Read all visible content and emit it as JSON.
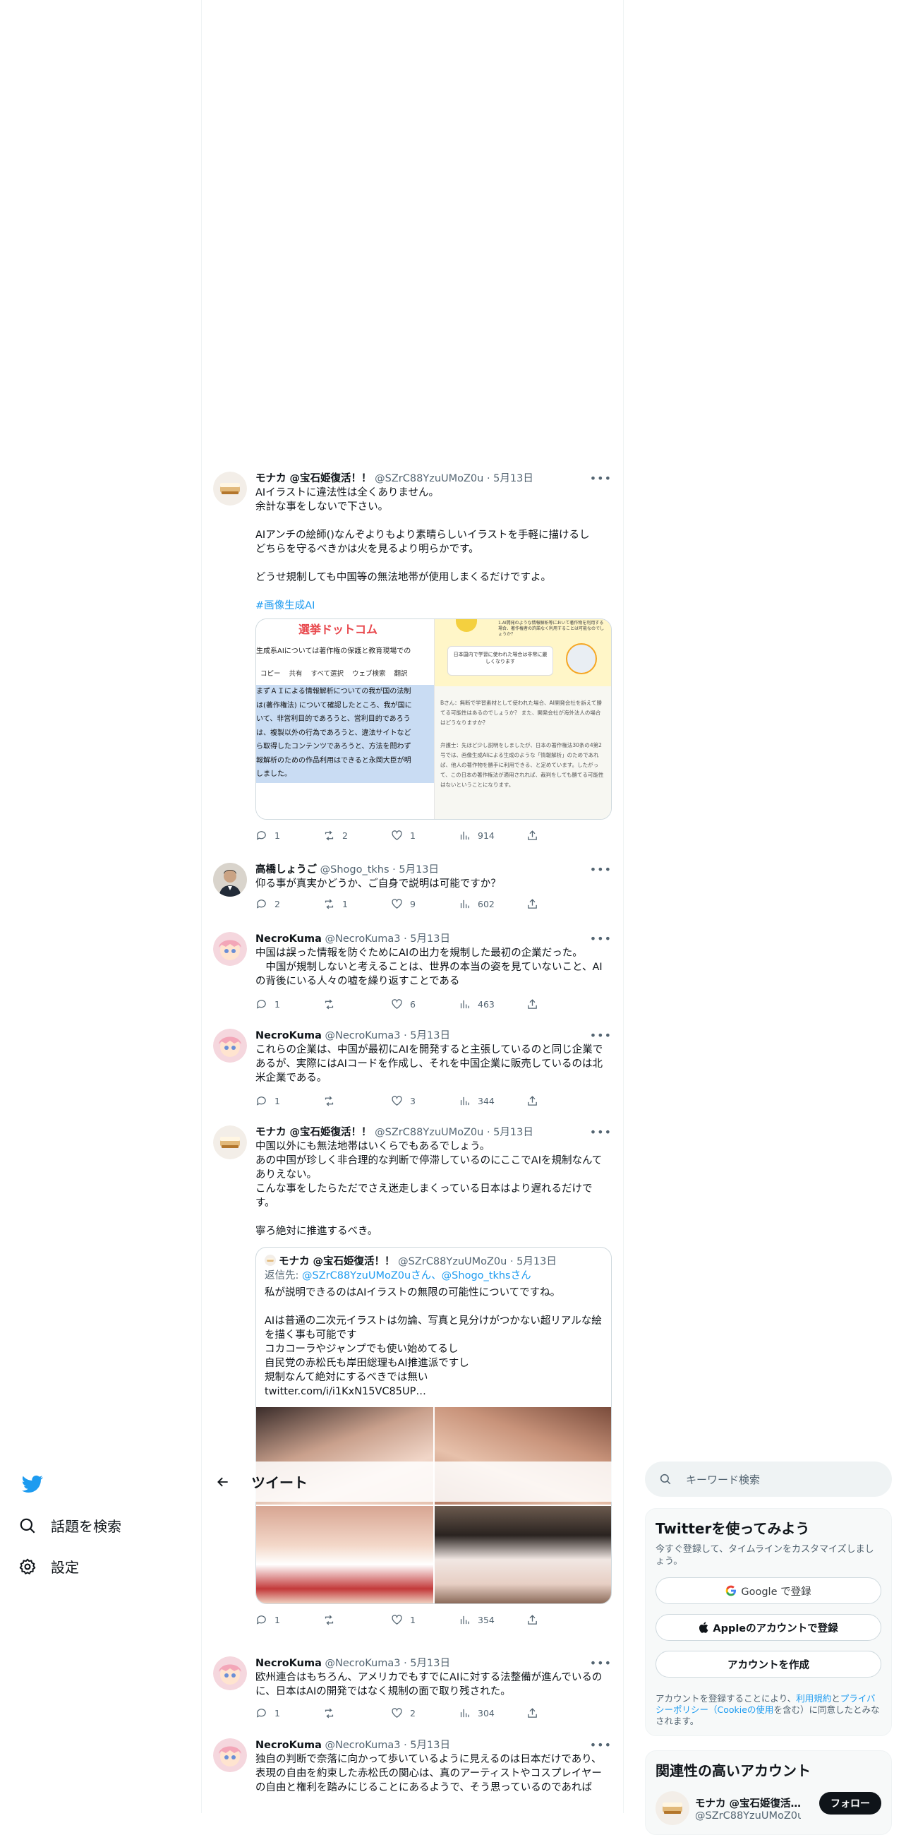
{
  "nav": {
    "logo_icon": "twitter-bird-icon",
    "explore_label": "話題を検索",
    "settings_label": "設定"
  },
  "header": {
    "back_icon": "arrow-left-icon",
    "title": "ツイート"
  },
  "colors": {
    "accent": "#1d9bf0",
    "text": "#0f1419",
    "muted": "#536471",
    "border": "#cfd9de"
  },
  "tweets": [
    {
      "name": "モナカ @宝石姫復活！！",
      "handle": "@SZrC88YzuUMoZ0u",
      "date": "· 5月13日",
      "text": "AIイラストに違法性は全くありません。\n余計な事をしないで下さい。\n\nAIアンチの絵師()なんぞよりもより素晴らしいイラストを手軽に描けるし\nどちらを守るべきかは火を見るより明らかです。\n\nどうせ規制しても中国等の無法地帯が使用しまくるだけですよ。",
      "hashtag": "#画像生成AI",
      "media": {
        "left": {
          "site": "選挙ドットコム",
          "lead": "生成系AIについては著作権の保護と教育現場での",
          "menu": [
            "コピー",
            "共有",
            "すべて選択",
            "ウェブ検索",
            "翻訳"
          ],
          "lines": [
            "まずＡＩによる情報解析についての我が国の法制",
            "は(著作権法) について確認したところ、我が国に",
            "いて、非営利目的であろうと、営利目的であろう",
            "は、複製以外の行為であろうと、違法サイトなど",
            "ら取得したコンテンツであろうと、方法を問わず",
            "報解析のための作品利用はできると永岡大臣が明",
            "しました。"
          ]
        },
        "right": {
          "bubble_top": "1.AI開発のような情報解析等において著作物を利用する場合、著作権者の許諾なく利用することは可能なのでしょうか？",
          "bubble": "日本国内で学習に使われた場合は非常に厳しくなります",
          "q": "Bさん：無断で学習素材として使われた場合、AI開発会社を訴えて勝てる可能性はあるのでしょうか？ また、開発会社が海外法人の場合はどうなりますか？",
          "a": "弁護士：先ほど少し説明をしましたが、日本の著作権法30条の4第2号では、画像生成AIによる生成のような「情報解析」のためであれば、他人の著作物を勝手に利用できる、と定めています。したがって、この日本の著作権法が適用されれば、裁判をしても勝てる可能性はないということになります。"
        }
      },
      "counts": {
        "reply": "1",
        "retweet": "2",
        "like": "1",
        "views": "914"
      }
    },
    {
      "name": "高橋しょうご",
      "handle": "@Shogo_tkhs",
      "date": "· 5月13日",
      "text": "仰る事が真実かどうか、ご自身で説明は可能ですか？",
      "counts": {
        "reply": "2",
        "retweet": "1",
        "like": "9",
        "views": "602"
      }
    },
    {
      "name": "NecroKuma",
      "handle": "@NecroKuma3",
      "date": "· 5月13日",
      "text": "中国は誤った情報を防ぐためにAIの出力を規制した最初の企業だった。\n　中国が規制しないと考えることは、世界の本当の姿を見ていないこと、AIの背後にいる人々の嘘を繰り返すことである",
      "counts": {
        "reply": "1",
        "retweet": "",
        "like": "6",
        "views": "463"
      }
    },
    {
      "name": "NecroKuma",
      "handle": "@NecroKuma3",
      "date": "· 5月13日",
      "text": "これらの企業は、中国が最初にAIを開発すると主張しているのと同じ企業であるが、実際にはAIコードを作成し、それを中国企業に販売しているのは北米企業である。",
      "counts": {
        "reply": "1",
        "retweet": "",
        "like": "3",
        "views": "344"
      }
    },
    {
      "name": "モナカ @宝石姫復活！！",
      "handle": "@SZrC88YzuUMoZ0u",
      "date": "· 5月13日",
      "text": "中国以外にも無法地帯はいくらでもあるでしょう。\nあの中国が珍しく非合理的な判断で停滞しているのにここでAIを規制なんてありえない。\nこんな事をしたらただでさえ迷走しまくっている日本はより遅れるだけです。\n\n寧ろ絶対に推進するべき。",
      "quote": {
        "name": "モナカ @宝石姫復活！！",
        "handle": "@SZrC88YzuUMoZ0u",
        "date": "· 5月13日",
        "reply_prefix": "返信先: ",
        "reply_to": "@SZrC88YzuUMoZ0uさん、@Shogo_tkhsさん",
        "text": "私が説明できるのはAIイラストの無限の可能性についてですね。\n\nAIは普通の二次元イラストは勿論、写真と見分けがつかない超リアルな絵を描く事も可能です\nコカコーラやジャンプでも使い始めてるし\n自民党の赤松氏も岸田総理もAI推進派ですし\n規制なんて絶対にするべきでは無い\ntwitter.com/i/i1KxN15VC85UP…"
      },
      "counts": {
        "reply": "1",
        "retweet": "",
        "like": "1",
        "views": "354"
      }
    },
    {
      "name": "NecroKuma",
      "handle": "@NecroKuma3",
      "date": "· 5月13日",
      "text": "欧州連合はもちろん、アメリカでもすでにAIに対する法整備が進んでいるのに、日本はAIの開発ではなく規制の面で取り残された。",
      "counts": {
        "reply": "1",
        "retweet": "",
        "like": "2",
        "views": "304"
      }
    },
    {
      "name": "NecroKuma",
      "handle": "@NecroKuma3",
      "date": "· 5月13日",
      "text": "独自の判断で奈落に向かって歩いているように見えるのは日本だけであり、表現の自由を約束した赤松氏の関心は、真のアーティストやコスプレイヤーの自由と権利を踏みにじることにあるようで、そう思っているのであれば"
    }
  ],
  "sidebar": {
    "search_placeholder": "キーワード検索",
    "signup_title": "Twitterを使ってみよう",
    "signup_sub": "今すぐ登録して、タイムラインをカスタマイズしましょう。",
    "google_btn": "Google で登録",
    "apple_btn": "Appleのアカウントで登録",
    "create_btn": "アカウントを作成",
    "legal_prefix": "アカウントを登録することにより、",
    "legal_terms": "利用規約",
    "legal_mid": "と",
    "legal_privacy": "プライバシーポリシー（Cookieの使用",
    "legal_suffix": "を含む）に同意したとみなされます。",
    "relevant_title": "関連性の高いアカウント",
    "relevant_name": "モナカ @宝石姫復活…",
    "relevant_handle": "@SZrC88YzuUMoZ0u",
    "follow_btn": "フォロー"
  }
}
